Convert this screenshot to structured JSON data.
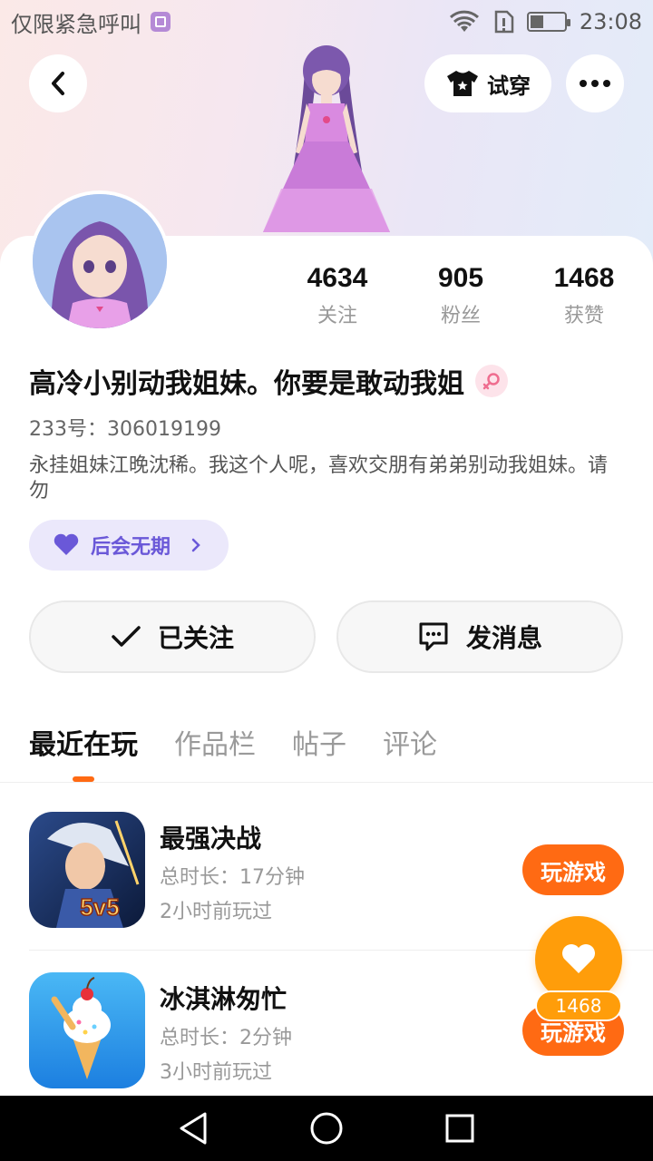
{
  "status_bar": {
    "carrier_text": "仅限紧急呼叫",
    "time": "23:08"
  },
  "header": {
    "tryon_label": "试穿"
  },
  "profile": {
    "stats": [
      {
        "value": "4634",
        "label": "关注"
      },
      {
        "value": "905",
        "label": "粉丝"
      },
      {
        "value": "1468",
        "label": "获赞"
      }
    ],
    "nickname": "高冷小别动我姐妹。你要是敢动我姐",
    "uid": "233号：306019199",
    "bio": "永挂姐妹江晚沈稀。我这个人呢，喜欢交朋有弟弟别动我姐妹。请勿",
    "tag_label": "后会无期"
  },
  "actions": {
    "follow_label": "已关注",
    "message_label": "发消息"
  },
  "tabs": [
    "最近在玩",
    "作品栏",
    "帖子",
    "评论"
  ],
  "games": [
    {
      "name": "最强决战",
      "duration": "总时长：17分钟",
      "last_played": "2小时前玩过",
      "button": "玩游戏",
      "badge": "5v5"
    },
    {
      "name": "冰淇淋匆忙",
      "duration": "总时长：2分钟",
      "last_played": "3小时前玩过",
      "button": "玩游戏"
    }
  ],
  "like_fab": {
    "count": "1468"
  },
  "colors": {
    "accent": "#ff6a13",
    "like": "#ff9d0a",
    "tag_bg": "#ebe8fb",
    "tag_text": "#6a58d8"
  }
}
